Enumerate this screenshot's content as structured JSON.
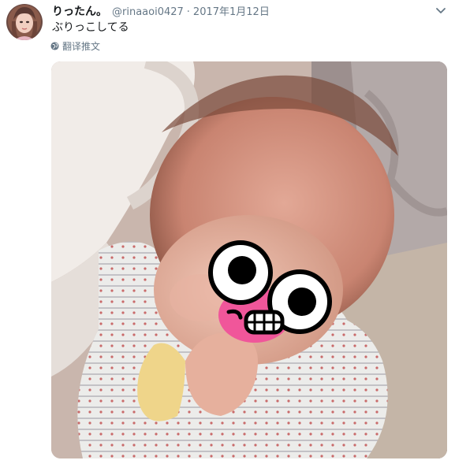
{
  "tweet": {
    "name": "りったん。",
    "handle": "@rinaaoi0427",
    "separator": "·",
    "date": "2017年1月12日",
    "text": "ぶりっこしてる",
    "translate_label": "翻译推文"
  },
  "colors": {
    "secondary_text": "#657786",
    "primary_text": "#14171a"
  }
}
